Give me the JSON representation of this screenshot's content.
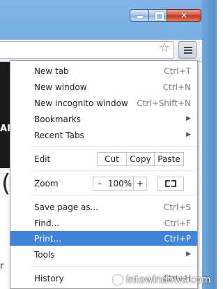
{
  "menu": {
    "items_top": [
      {
        "label": "New tab",
        "shortcut": "Ctrl+T"
      },
      {
        "label": "New window",
        "shortcut": "Ctrl+N"
      },
      {
        "label": "New incognito window",
        "shortcut": "Ctrl+Shift+N"
      },
      {
        "label": "Bookmarks",
        "shortcut": ""
      },
      {
        "label": "Recent Tabs",
        "shortcut": ""
      }
    ],
    "edit": {
      "label": "Edit",
      "cut": "Cut",
      "copy": "Copy",
      "paste": "Paste"
    },
    "zoom": {
      "label": "Zoom",
      "minus": "–",
      "level": "100%",
      "plus": "+"
    },
    "items_bottom": [
      {
        "label": "Save page as...",
        "shortcut": "Ctrl+S"
      },
      {
        "label": "Find...",
        "shortcut": "Ctrl+F"
      },
      {
        "label": "Print...",
        "shortcut": "Ctrl+P"
      },
      {
        "label": "Tools",
        "shortcut": ""
      }
    ],
    "history": {
      "label": "History",
      "shortcut": "Ctrl+H"
    }
  },
  "page": {
    "side_text": "AR",
    "paren": "(",
    "side_letter": "r"
  },
  "watermark": "intowindows.com",
  "colors": {
    "highlight": "#3f84d8",
    "frame": "#6da6dc"
  }
}
